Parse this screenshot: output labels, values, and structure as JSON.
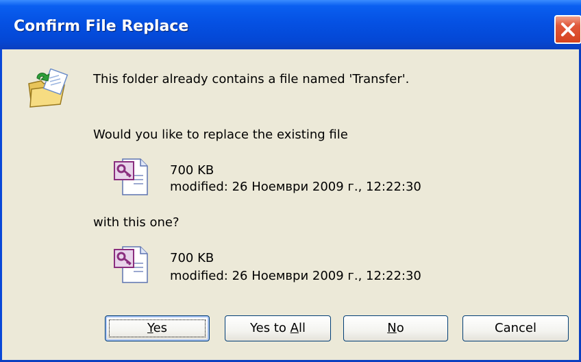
{
  "window": {
    "title": "Confirm File Replace"
  },
  "message": {
    "line1": "This folder already contains a file named 'Transfer'.",
    "question": "Would you like to replace the existing file",
    "with": "with this one?"
  },
  "existing_file": {
    "size": "700 KB",
    "modified": "modified: 26 Ноември 2009 г., 12:22:30"
  },
  "new_file": {
    "size": "700 KB",
    "modified": "modified: 26 Ноември 2009 г., 12:22:30"
  },
  "buttons": {
    "yes": {
      "pre": "",
      "key": "Y",
      "post": "es"
    },
    "yes_all": {
      "pre": "Yes to ",
      "key": "A",
      "post": "ll"
    },
    "no": {
      "pre": "",
      "key": "N",
      "post": "o"
    },
    "cancel": "Cancel"
  },
  "icons": {
    "title_close": "close-icon",
    "folder": "folder-replace-icon",
    "file": "access-file-icon"
  },
  "colors": {
    "titlebar": "#0551e3",
    "client": "#ece9d8",
    "close": "#d5431f"
  }
}
